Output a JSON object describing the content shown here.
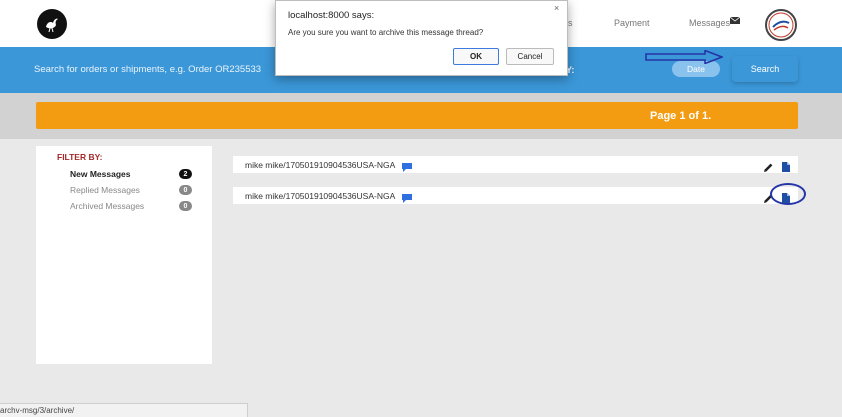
{
  "nav": {
    "orders_partial": "rs",
    "payment": "Payment",
    "messages": "Messages"
  },
  "search": {
    "placeholder": "Search for orders or shipments, e.g. Order OR235533",
    "filter_label_partial": "Y:",
    "date_label": "Date",
    "search_label": "Search"
  },
  "pagination": {
    "text": "Page 1 of 1."
  },
  "sidebar": {
    "title": "FILTER BY:",
    "items": [
      {
        "label": "New Messages",
        "count": "2",
        "active": true
      },
      {
        "label": "Replied Messages",
        "count": "0",
        "active": false
      },
      {
        "label": "Archived Messages",
        "count": "0",
        "active": false
      }
    ]
  },
  "messages": [
    {
      "text": "mike mike/170501910904536USA-NGA"
    },
    {
      "text": "mike mike/170501910904536USA-NGA"
    }
  ],
  "dialog": {
    "title": "localhost:8000 says:",
    "message": "Are you sure you want to archive this message thread?",
    "ok_label": "OK",
    "cancel_label": "Cancel",
    "close_glyph": "×"
  },
  "status_bar": {
    "url": "archv-msg/3/archive/"
  },
  "colors": {
    "primary_blue": "#3b97d8",
    "orange": "#f39c12",
    "annotation_blue": "#2435a8",
    "filter_red": "#a52a2a"
  },
  "icons": {
    "left_logo": "bird-logo-icon",
    "right_logo": "brand-logo-icon",
    "mail": "mail-icon",
    "chat": "chat-bubble-icon",
    "edit": "pencil-icon",
    "archive": "document-icon"
  }
}
